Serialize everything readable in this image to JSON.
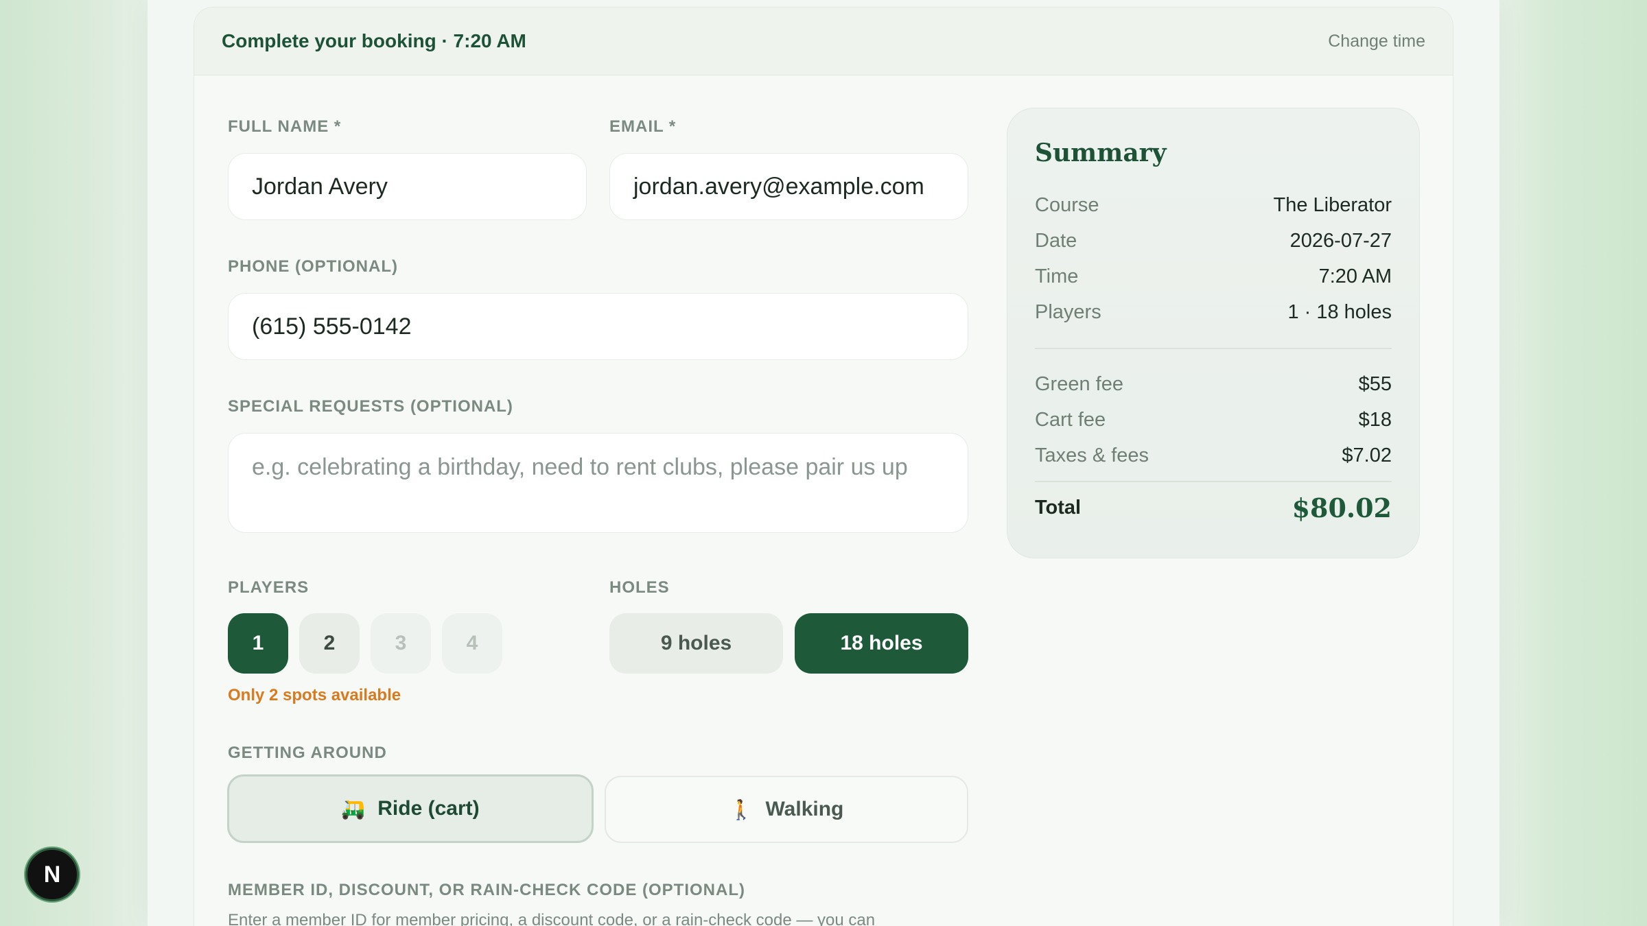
{
  "header": {
    "title": "Complete your booking · 7:20 AM",
    "change_time": "Change time"
  },
  "form": {
    "full_name_label": "FULL NAME *",
    "full_name_value": "Jordan Avery",
    "email_label": "EMAIL *",
    "email_value": "jordan.avery@example.com",
    "phone_label": "PHONE (OPTIONAL)",
    "phone_value": "(615) 555-0142",
    "requests_label": "SPECIAL REQUESTS (OPTIONAL)",
    "requests_placeholder": "e.g. celebrating a birthday, need to rent clubs, please pair us up",
    "players_label": "PLAYERS",
    "players_options": [
      "1",
      "2",
      "3",
      "4"
    ],
    "players_selected": "1",
    "spots_warning": "Only 2 spots available",
    "holes_label": "HOLES",
    "holes_options": [
      "9 holes",
      "18 holes"
    ],
    "holes_selected": "18 holes",
    "getting_around_label": "GETTING AROUND",
    "ride_option": "Ride (cart)",
    "walking_option": "Walking",
    "ride_icon": "🛺",
    "walking_icon": "🚶",
    "member_label": "MEMBER ID, DISCOUNT, OR RAIN-CHECK CODE (OPTIONAL)",
    "member_help": "Enter a member ID for member pricing, a discount code, or a rain-check code — you can"
  },
  "summary": {
    "title": "Summary",
    "rows": [
      {
        "key": "Course",
        "value": "The Liberator"
      },
      {
        "key": "Date",
        "value": "2026-07-27"
      },
      {
        "key": "Time",
        "value": "7:20 AM"
      },
      {
        "key": "Players",
        "value": "1 · 18 holes"
      }
    ],
    "fees": [
      {
        "key": "Green fee",
        "value": "$55"
      },
      {
        "key": "Cart fee",
        "value": "$18"
      },
      {
        "key": "Taxes & fees",
        "value": "$7.02"
      }
    ],
    "total_label": "Total",
    "total_value": "$80.02"
  },
  "badge": {
    "letter": "N"
  },
  "colors": {
    "accent": "#1e5a3a",
    "warning": "#d97a1e"
  }
}
